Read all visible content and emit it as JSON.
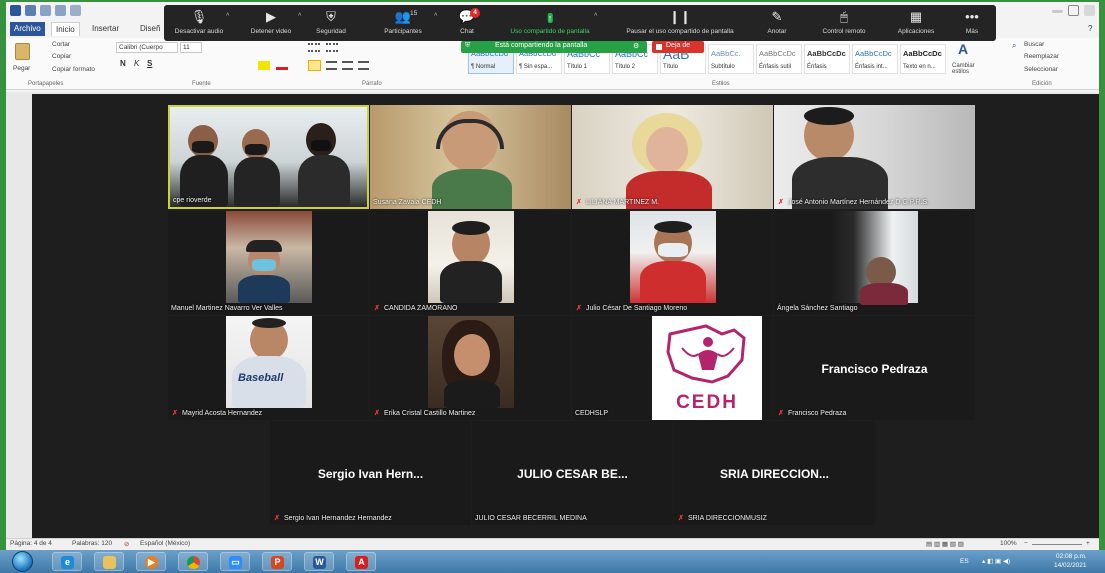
{
  "word": {
    "tabs": [
      "Archivo",
      "Inicio",
      "Insertar",
      "Diseñ"
    ],
    "clipboard": {
      "paste": "Pegar",
      "cut": "Cortar",
      "copy": "Copiar",
      "format_painter": "Copiar formato",
      "group": "Portapapeles"
    },
    "font": {
      "family": "Calibri (Cuerpo",
      "size": "11",
      "group": "Fuente"
    },
    "paragraph_group": "Párrafo",
    "styles": {
      "items": [
        {
          "sample": "AaBbCcDd",
          "name": "¶ Normal"
        },
        {
          "sample": "AaBbCcDd",
          "name": "¶ Sin espa..."
        },
        {
          "sample": "AaBbCc",
          "name": "Título 1"
        },
        {
          "sample": "AaBbCc",
          "name": "Título 2"
        },
        {
          "sample": "AaB",
          "name": "Título"
        },
        {
          "sample": "AaBbCc.",
          "name": "Subtítulo"
        },
        {
          "sample": "AaBbCcDc",
          "name": "Énfasis sutil"
        },
        {
          "sample": "AaBbCcDc",
          "name": "Énfasis"
        },
        {
          "sample": "AaBbCcDc",
          "name": "Énfasis int..."
        },
        {
          "sample": "AaBbCcDc",
          "name": "Texto en n..."
        }
      ],
      "change": "Cambiar estilos",
      "group": "Estilos"
    },
    "editing": {
      "find": "Buscar",
      "replace": "Reemplazar",
      "select": "Seleccionar",
      "group": "Edición"
    },
    "status": {
      "page": "Página: 4 de 4",
      "words": "Palabras: 120",
      "language": "Español (México)",
      "zoom": "100%"
    }
  },
  "zoom": {
    "toolbar": [
      {
        "label": "Desactivar audio",
        "icon": "microphone-icon"
      },
      {
        "label": "Detener video",
        "icon": "video-camera-icon"
      },
      {
        "label": "Seguridad",
        "icon": "shield-icon"
      },
      {
        "label": "Participantes",
        "icon": "participants-icon",
        "count": "15"
      },
      {
        "label": "Chat",
        "icon": "chat-icon",
        "badge": "4"
      },
      {
        "label": "Uso compartido de pantalla",
        "icon": "share-screen-icon"
      },
      {
        "label": "Pausar el uso compartido de pantalla",
        "icon": "pause-icon"
      },
      {
        "label": "Anotar",
        "icon": "pen-icon"
      },
      {
        "label": "Control remoto",
        "icon": "mouse-icon"
      },
      {
        "label": "Aplicaciones",
        "icon": "apps-icon"
      },
      {
        "label": "Más",
        "icon": "more-icon"
      }
    ],
    "sharing_banner": "Está compartiendo la pantalla",
    "stop_share": "Deja de"
  },
  "participants": [
    {
      "name": "cpe rioverde",
      "muted": false,
      "speaking": true
    },
    {
      "name": "Susana Zavala CEDH",
      "muted": false,
      "speaking": false
    },
    {
      "name": "LILIANA MARTINEZ M.",
      "muted": true,
      "speaking": false
    },
    {
      "name": "José Antonio Martínez Hernández D.G.P.R.S.",
      "muted": true,
      "speaking": false
    },
    {
      "name": "Manuel Martinez Navarro Ver Valles",
      "muted": false,
      "speaking": false
    },
    {
      "name": "CANDIDA ZAMORANO",
      "muted": true,
      "speaking": false
    },
    {
      "name": "Julio César De Santiago Moreno",
      "muted": true,
      "speaking": false
    },
    {
      "name": "Ángela Sánchez Santiago",
      "muted": false,
      "speaking": false
    },
    {
      "name": "Mayrid Acosta Hernandez",
      "muted": true,
      "speaking": false
    },
    {
      "name": "Erika Cristal Castillo Martinez",
      "muted": true,
      "speaking": false
    },
    {
      "name": "CEDHSLP",
      "muted": false,
      "speaking": false,
      "logo_text": "CEDH"
    },
    {
      "name": "Francisco Pedraza",
      "muted": true,
      "speaking": false,
      "display": "Francisco Pedraza"
    },
    {
      "name": "Sergio Ivan Hernandez Hernandez",
      "muted": true,
      "speaking": false,
      "display": "Sergio Ivan Hern..."
    },
    {
      "name": "JULIO CESAR BECERRIL MEDINA",
      "muted": false,
      "speaking": false,
      "display": "JULIO CESAR BE..."
    },
    {
      "name": "SRIA DIRECCIONMUSIZ",
      "muted": true,
      "speaking": false,
      "display": "SRIA DIRECCION..."
    }
  ],
  "taskbar": {
    "apps": [
      "ie-icon",
      "folder-icon",
      "media-player-icon",
      "chrome-icon",
      "zoom-icon",
      "powerpoint-icon",
      "word-icon",
      "acrobat-icon"
    ],
    "lang": "ES",
    "time": "02:08 p.m.",
    "date": "14/02/2021"
  },
  "colors": {
    "zoom_green": "#23b04e",
    "stop_red": "#d9342b",
    "speaker_border": "#c9d13b",
    "cedh_magenta": "#b3246c"
  }
}
